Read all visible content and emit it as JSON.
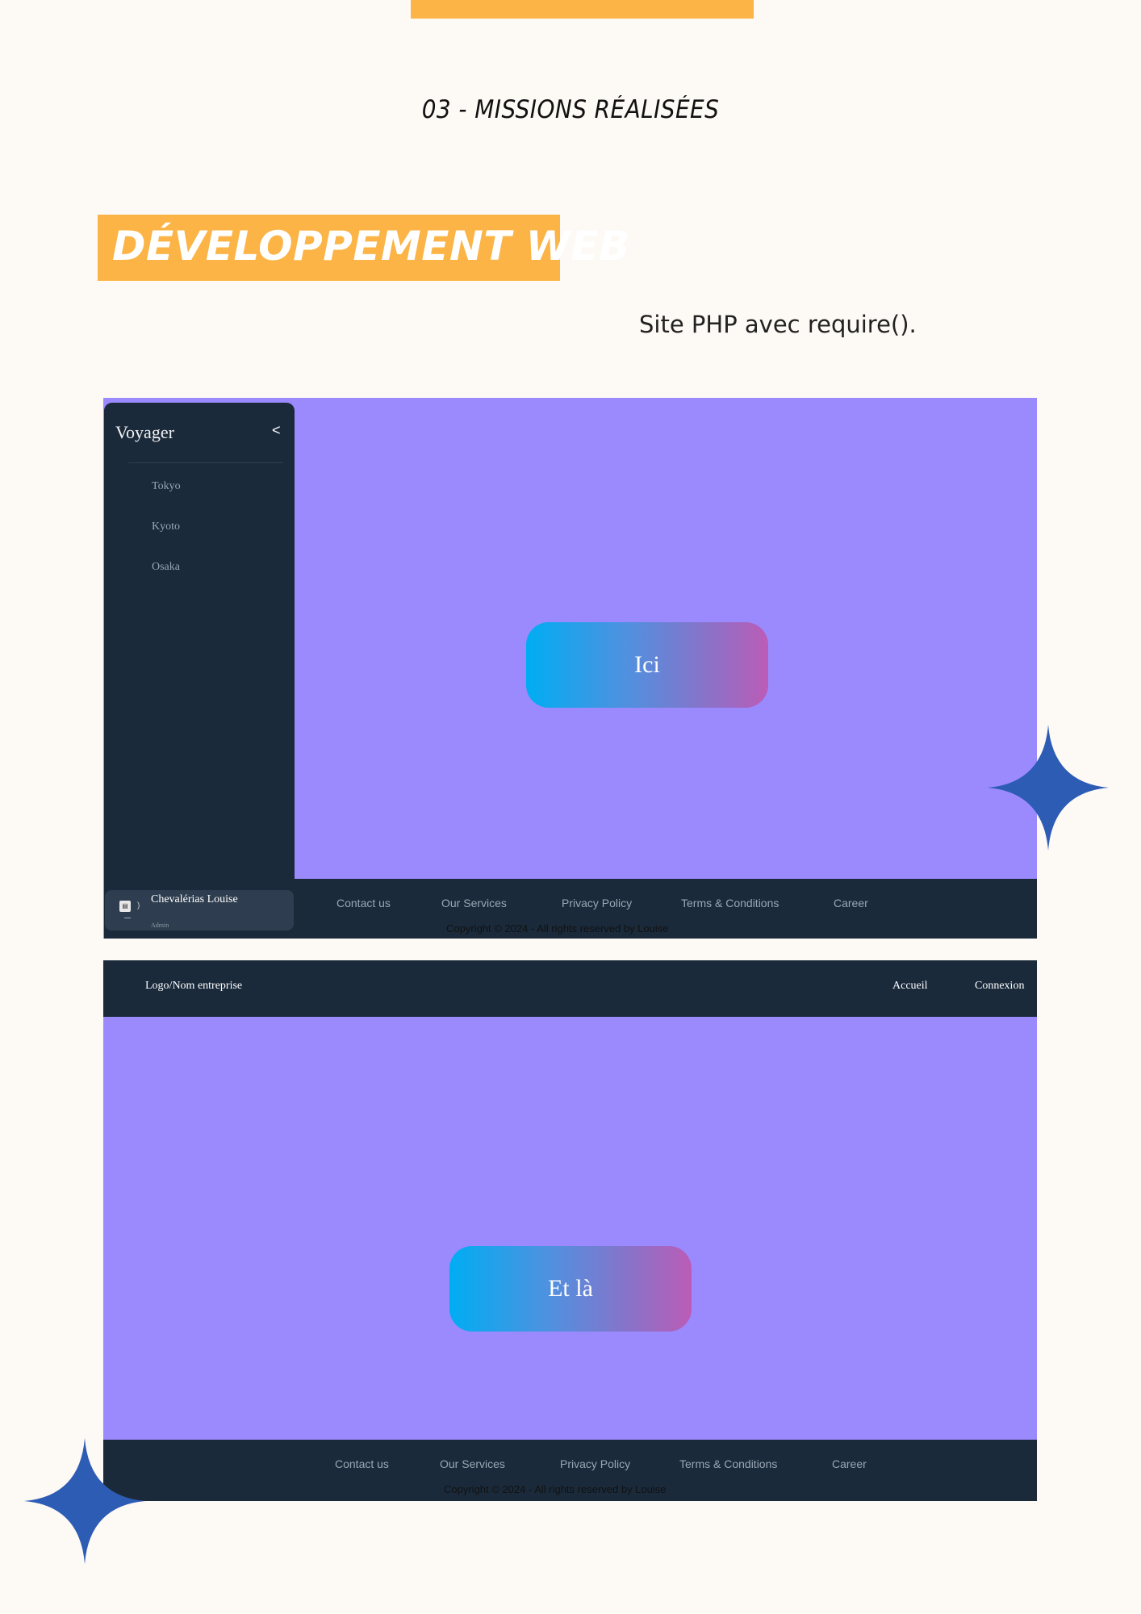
{
  "page": {
    "section_title": "03 - MISSIONS RÉALISÉES",
    "heading": "DÉVELOPPEMENT WEB",
    "description": "Site PHP avec require()."
  },
  "screenshot1": {
    "sidebar": {
      "title": "Voyager",
      "toggle": "<",
      "items": [
        "Tokyo",
        "Kyoto",
        "Osaka"
      ],
      "profile": {
        "name": "Chevalérias Louise",
        "role": "Admin"
      }
    },
    "button_label": "Ici",
    "footer": {
      "links": [
        "Contact us",
        "Our Services",
        "Privacy Policy",
        "Terms & Conditions",
        "Career"
      ],
      "copyright": "Copyright © 2024 - All rights reserved by Louise"
    }
  },
  "screenshot2": {
    "header": {
      "logo": "Logo/Nom entreprise",
      "nav": [
        "Accueil",
        "Connexion"
      ]
    },
    "button_label": "Et là",
    "footer": {
      "links": [
        "Contact us",
        "Our Services",
        "Privacy Policy",
        "Terms & Conditions",
        "Career"
      ],
      "copyright": "Copyright © 2024 - All rights reserved by Louise"
    }
  },
  "colors": {
    "accent_orange": "#fbb445",
    "background": "#fdf9f5",
    "mock_background": "#9b8afe",
    "mock_dark": "#1a2a3b",
    "star_blue": "#2d5cb5"
  }
}
